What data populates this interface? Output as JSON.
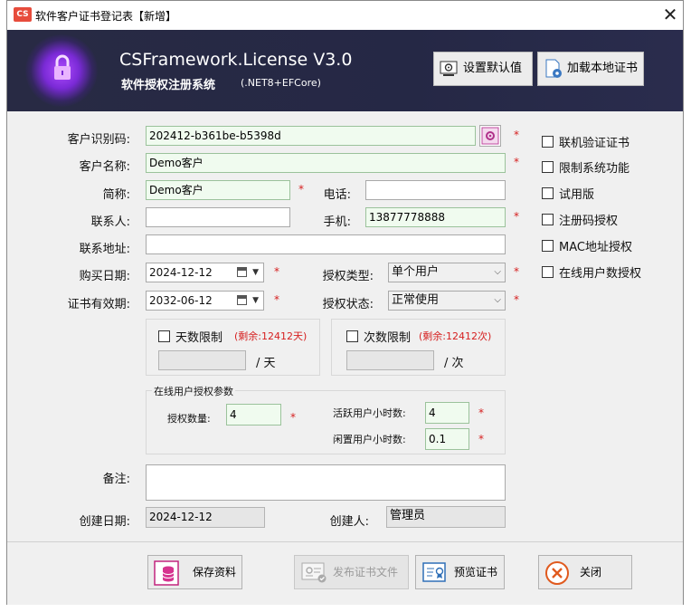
{
  "window": {
    "title": "软件客户证书登记表【新增】",
    "app_icon": "CS"
  },
  "banner": {
    "title": "CSFramework.License V3.0",
    "subtitle": "软件授权注册系统",
    "tech": "(.NET8+EFCore)",
    "btn_default": "设置默认值",
    "btn_load_cert": "加载本地证书"
  },
  "form": {
    "customer_id_label": "客户识别码:",
    "customer_id": "202412-b361be-b5398d",
    "customer_name_label": "客户名称:",
    "customer_name": "Demo客户",
    "short_name_label": "简称:",
    "short_name": "Demo客户",
    "phone_label": "电话:",
    "phone": "",
    "contact_label": "联系人:",
    "contact": "",
    "mobile_label": "手机:",
    "mobile": "13877778888",
    "address_label": "联系地址:",
    "address": "",
    "purchase_date_label": "购买日期:",
    "purchase_date": "2024-12-12",
    "license_type_label": "授权类型:",
    "license_type": "单个用户",
    "expire_label": "证书有效期:",
    "expire_date": "2032-06-12",
    "license_status_label": "授权状态:",
    "license_status": "正常使用",
    "days_limit_label": "天数限制",
    "days_remaining": "(剩余:12412天)",
    "days_unit": "/ 天",
    "times_limit_label": "次数限制",
    "times_remaining": "(剩余:12412次)",
    "times_unit": "/ 次",
    "online_group_title": "在线用户授权参数",
    "license_count_label": "授权数量:",
    "license_count": "4",
    "active_hours_label": "活跃用户小时数:",
    "active_hours": "4",
    "idle_hours_label": "闲置用户小时数:",
    "idle_hours": "0.1",
    "remark_label": "备注:",
    "remark": "",
    "created_date_label": "创建日期:",
    "created_date": "2024-12-12",
    "creator_label": "创建人:",
    "creator": "管理员",
    "required_mark": "*"
  },
  "options": {
    "online_verify": "联机验证证书",
    "limit_features": "限制系统功能",
    "trial": "试用版",
    "reg_code": "注册码授权",
    "mac": "MAC地址授权",
    "online_users": "在线用户数授权"
  },
  "footer": {
    "save": "保存资料",
    "publish": "发布证书文件",
    "preview": "预览证书",
    "close": "关闭"
  },
  "colors": {
    "banner_bg": "#282a44",
    "required": "#d62020",
    "highlight_field": "#f0fbef"
  }
}
